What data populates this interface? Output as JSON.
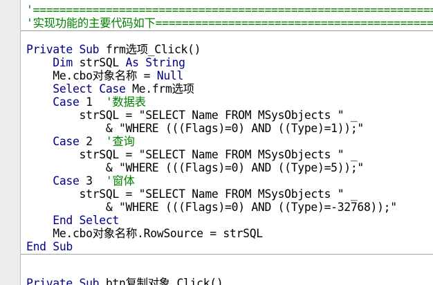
{
  "editor": {
    "colors": {
      "keyword": "#00008B",
      "text": "#000000",
      "comment": "#008000",
      "background": "#FFFFFF",
      "gutter": "#ECECEC",
      "separator": "#A0A0A0"
    },
    "lines": {
      "l0": {
        "a": "'==================================================================="
      },
      "l1": {
        "a": "'实现功能的主要代码如下=================================================="
      },
      "l2": {
        "a": "Private Sub",
        "b": " frm选项_Click()"
      },
      "l3": {
        "i": "    ",
        "a": "Dim",
        "b": " strSQL ",
        "c": "As String"
      },
      "l4": {
        "i": "    ",
        "a": "Me.cbo对象名称 = ",
        "b": "Null"
      },
      "l5": {
        "i": "    ",
        "a": "Select Case",
        "b": " Me.frm选项"
      },
      "l6": {
        "i": "    ",
        "a": "Case",
        "b": " 1  ",
        "c": "'数据表"
      },
      "l7": {
        "i": "        ",
        "a": "strSQL = \"SELECT Name FROM MSysObjects \" _"
      },
      "l8": {
        "i": "            ",
        "a": "& \"WHERE (((Flags)=0) AND ((Type)=1));\""
      },
      "l9": {
        "i": "    ",
        "a": "Case",
        "b": " 2  ",
        "c": "'查询"
      },
      "l10": {
        "i": "        ",
        "a": "strSQL = \"SELECT Name FROM MSysObjects \" _"
      },
      "l11": {
        "i": "            ",
        "a": "& \"WHERE (((Flags)=0) AND ((Type)=5));\""
      },
      "l12": {
        "i": "    ",
        "a": "Case",
        "b": " 3  ",
        "c": "'窗体"
      },
      "l13": {
        "i": "        ",
        "a": "strSQL = \"SELECT Name FROM MSysObjects \" _"
      },
      "l14": {
        "i": "            ",
        "a": "& \"WHERE (((Flags)=0) AND ((Type)=-32768));\""
      },
      "l15": {
        "i": "    ",
        "a": "End Select"
      },
      "l16": {
        "i": "    ",
        "a": "Me.cbo对象名称.RowSource = strSQL"
      },
      "l17": {
        "a": "End Sub"
      },
      "l18": {
        "a": "Private Sub",
        "b": " btn复制对象_Click()"
      }
    }
  }
}
